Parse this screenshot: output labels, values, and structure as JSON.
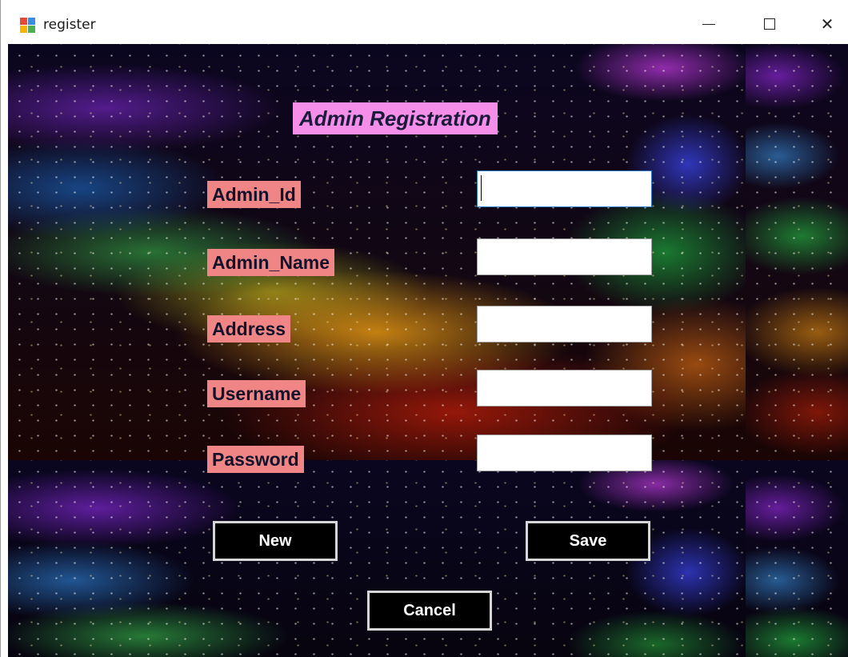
{
  "window": {
    "title": "register",
    "icon": "windows-form-icon",
    "controls": {
      "minimize": "minimize-icon",
      "maximize": "maximize-icon",
      "close": "close-icon",
      "close_glyph": "✕"
    }
  },
  "form": {
    "title": "Admin Registration",
    "fields": [
      {
        "label": "Admin_Id",
        "value": ""
      },
      {
        "label": "Admin_Name",
        "value": ""
      },
      {
        "label": "Address",
        "value": ""
      },
      {
        "label": "Username",
        "value": ""
      },
      {
        "label": "Password",
        "value": ""
      }
    ],
    "buttons": {
      "new": "New",
      "save": "Save",
      "cancel": "Cancel"
    }
  },
  "colors": {
    "title_bg": "#f58ee8",
    "label_bg": "#f08585",
    "button_bg": "#000000",
    "button_border": "#d6d6d6",
    "focus_border": "#2a78c8"
  }
}
